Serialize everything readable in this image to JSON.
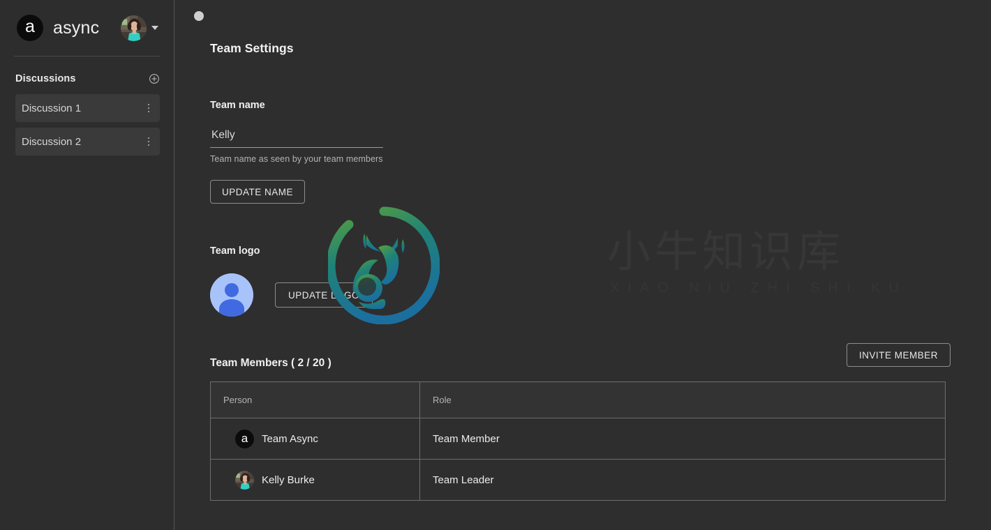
{
  "sidebar": {
    "brand": {
      "logo_letter": "a",
      "name": "async"
    },
    "user_menu": {
      "avatar": "user-photo-avatar",
      "caret": "chevron-down-icon"
    },
    "discussions_section": {
      "title": "Discussions",
      "add_icon": "plus-circle-icon",
      "items": [
        {
          "label": "Discussion 1",
          "menu_icon": "kebab-menu-icon"
        },
        {
          "label": "Discussion 2",
          "menu_icon": "kebab-menu-icon"
        }
      ]
    }
  },
  "main": {
    "status_dot": "status-dot",
    "page_title": "Team Settings",
    "team_name": {
      "label": "Team name",
      "value": "Kelly",
      "placeholder": "Team name",
      "helper": "Team name as seen by your team members",
      "update_button": "UPDATE NAME"
    },
    "team_logo": {
      "label": "Team logo",
      "avatar_icon": "default-person-avatar-icon",
      "update_button": "UPDATE LOGO"
    },
    "members": {
      "heading": "Team Members ( 2 / 20 )",
      "count_current": 2,
      "count_max": 20,
      "invite_button": "INVITE MEMBER",
      "columns": [
        "Person",
        "Role"
      ],
      "rows": [
        {
          "avatar": "async-logo-avatar",
          "name": "Team Async",
          "role": "Team Member"
        },
        {
          "avatar": "kelly-photo-avatar",
          "name": "Kelly Burke",
          "role": "Team Leader"
        }
      ]
    }
  },
  "watermark": {
    "mark": "deer-in-circle-logo",
    "text_cn": "小牛知识库",
    "text_pinyin": "XIAO NIU ZHI SHI KU"
  },
  "colors": {
    "app_background": "#2e2e2e",
    "sidebar_background": "#2d2d2d",
    "discussion_item_background": "#3a3a3a",
    "border": "#6e6e6e",
    "text_primary": "#f0f0f0",
    "text_muted": "#b3b3b3",
    "avatar_blue_light": "#a8c3fa",
    "avatar_blue_dark": "#4169e1",
    "logo_black": "#0b0b0b",
    "watermark_green": "#4f9a3c",
    "watermark_blue": "#1d6f9e"
  }
}
